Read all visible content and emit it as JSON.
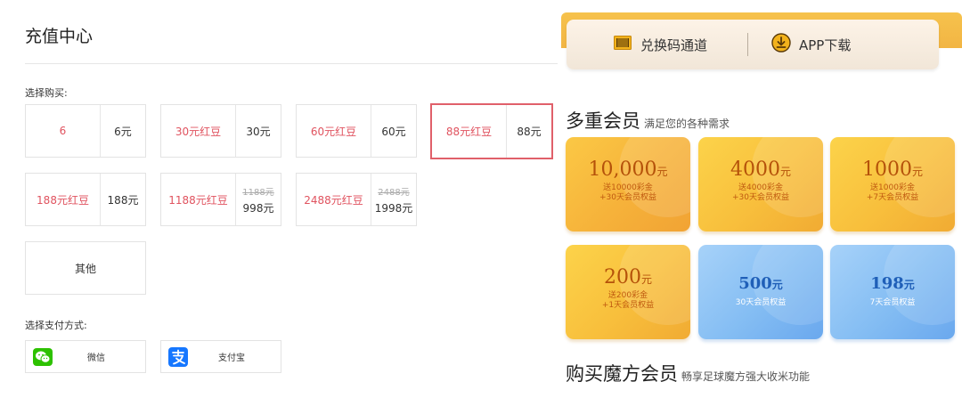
{
  "recharge": {
    "title": "充值中心",
    "buy_label": "选择购买:",
    "pay_label": "选择支付方式:",
    "packages": [
      {
        "name": "6",
        "price": "6元"
      },
      {
        "name": "30元红豆",
        "price": "30元"
      },
      {
        "name": "60元红豆",
        "price": "60元"
      },
      {
        "name": "88元红豆",
        "price": "88元",
        "selected": true
      },
      {
        "name": "188元红豆",
        "price": "188元"
      },
      {
        "name": "1188元红豆",
        "original": "1188元",
        "price": "998元"
      },
      {
        "name": "2488元红豆",
        "original": "2488元",
        "price": "1998元"
      }
    ],
    "other_label": "其他",
    "payments": [
      {
        "name": "微信",
        "icon": "wechat-icon",
        "color": "#2dc100"
      },
      {
        "name": "支付宝",
        "icon": "alipay-icon",
        "color": "#1677ff"
      }
    ]
  },
  "member": {
    "topbar": {
      "code_label": "兑换码通道",
      "code_icon": "ticket-icon",
      "app_label": "APP下载",
      "app_icon": "download-icon"
    },
    "multi_title": "多重会员",
    "multi_sub": "满足您的各种需求",
    "cards": [
      {
        "amount": "10,000",
        "unit": "元",
        "line1": "送10000彩金",
        "line2": "+30天会员权益",
        "style": "gold"
      },
      {
        "amount": "4000",
        "unit": "元",
        "line1": "送4000彩金",
        "line2": "+30天会员权益",
        "style": "gold"
      },
      {
        "amount": "1000",
        "unit": "元",
        "line1": "送1000彩金",
        "line2": "+7天会员权益",
        "style": "gold"
      },
      {
        "amount": "200",
        "unit": "元",
        "line1": "送200彩金",
        "line2": "+1天会员权益",
        "style": "gold"
      },
      {
        "amount": "500",
        "unit": "元",
        "line1": "30天会员权益",
        "line2": "",
        "style": "blue"
      },
      {
        "amount": "198",
        "unit": "元",
        "line1": "7天会员权益",
        "line2": "",
        "style": "blue"
      }
    ],
    "buy_title": "购买魔方会员",
    "buy_sub": "畅享足球魔方强大收米功能"
  },
  "colors": {
    "accent_red": "#e0606a",
    "gold": "#f8bf3c",
    "blue": "#84bdf3"
  }
}
